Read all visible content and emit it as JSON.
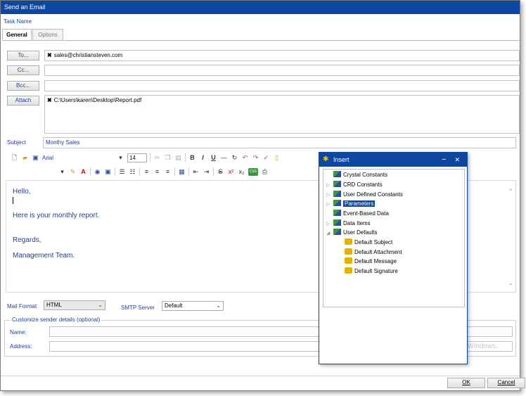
{
  "window": {
    "title": "Send an Email"
  },
  "task_name_label": "Task Name",
  "tabs": [
    {
      "label": "General"
    },
    {
      "label": "Options"
    }
  ],
  "recipients": {
    "to_label": "To...",
    "to_value": "sales@christiansteven.com",
    "cc_label": "Cc...",
    "bcc_label": "Bcc...",
    "attach_label": "Attach",
    "attach_value": "C:\\Users\\karen\\Desktop\\Report.pdf"
  },
  "subject": {
    "label": "Subject",
    "value": "Monthy Sales"
  },
  "toolbar": {
    "font_name": "Arial",
    "font_size": "14"
  },
  "body": {
    "lines": [
      "Hello,",
      "Here is your monthly report.",
      "Regards,",
      "Management Team."
    ]
  },
  "mail_format": {
    "label": "Mail Format",
    "value": "HTML"
  },
  "smtp": {
    "label": "SMTP Server",
    "value": "Default"
  },
  "sender": {
    "legend": "Customize sender details (optional)",
    "name_label": "Name:",
    "address_label": "Address:",
    "watermark": "Windows."
  },
  "footer": {
    "ok": "OK",
    "cancel": "Cancel"
  },
  "insert_dialog": {
    "title": "Insert",
    "minimize": "–",
    "close": "✕",
    "items": [
      {
        "label": "Crystal Constants"
      },
      {
        "label": "CRD Constants"
      },
      {
        "label": "User Defined Constants"
      },
      {
        "label": "Parameters"
      },
      {
        "label": "Event-Based Data"
      },
      {
        "label": "Data Items"
      },
      {
        "label": "User Defaults"
      },
      {
        "label": "Default Subject"
      },
      {
        "label": "Default Attachment"
      },
      {
        "label": "Default Message"
      },
      {
        "label": "Default Signature"
      }
    ]
  },
  "colors": {
    "titlebar": "#0d47a1",
    "label_text": "#1f3f8f"
  }
}
